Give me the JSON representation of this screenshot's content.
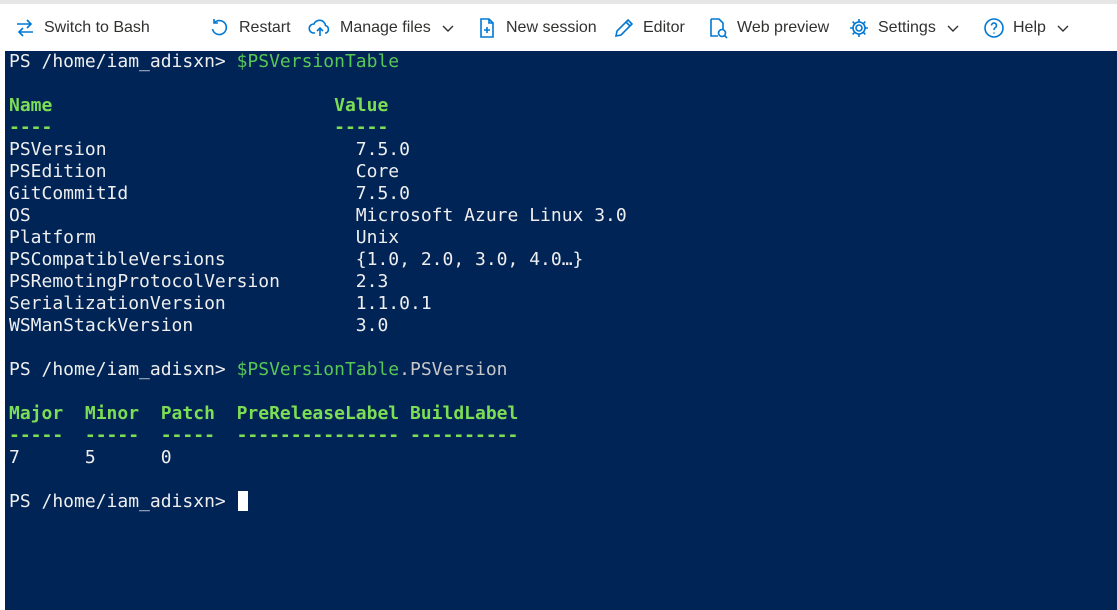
{
  "toolbar": {
    "switch_label": "Switch to Bash",
    "restart_label": "Restart",
    "manage_files_label": "Manage files",
    "new_session_label": "New session",
    "editor_label": "Editor",
    "web_preview_label": "Web preview",
    "settings_label": "Settings",
    "help_label": "Help"
  },
  "terminal": {
    "prompt": "PS /home/iam_adisxn> ",
    "cmd1": "$PSVersionTable",
    "table1": {
      "headers": [
        "Name",
        "Value"
      ],
      "underline": [
        "----",
        "-----"
      ],
      "rows": [
        [
          "PSVersion",
          "7.5.0"
        ],
        [
          "PSEdition",
          "Core"
        ],
        [
          "GitCommitId",
          "7.5.0"
        ],
        [
          "OS",
          "Microsoft Azure Linux 3.0"
        ],
        [
          "Platform",
          "Unix"
        ],
        [
          "PSCompatibleVersions",
          "{1.0, 2.0, 3.0, 4.0…}"
        ],
        [
          "PSRemotingProtocolVersion",
          "2.3"
        ],
        [
          "SerializationVersion",
          "1.1.0.1"
        ],
        [
          "WSManStackVersion",
          "3.0"
        ]
      ]
    },
    "cmd2_var": "$PSVersionTable",
    "cmd2_prop": ".PSVersion",
    "table2": {
      "header_line": "Major  Minor  Patch  PreReleaseLabel BuildLabel",
      "underline_line": "-----  -----  -----  --------------- ----------",
      "values_line": "7      5      0"
    }
  },
  "colors": {
    "terminal_bg": "#012456",
    "toolbar_icon": "#0078d4",
    "command": "#57c756",
    "header": "#7cde54"
  },
  "icons": [
    "switch-icon",
    "restart-icon",
    "cloud-upload-icon",
    "new-session-icon",
    "edit-icon",
    "web-preview-icon",
    "gear-icon",
    "help-icon",
    "chevron-down-icon"
  ]
}
